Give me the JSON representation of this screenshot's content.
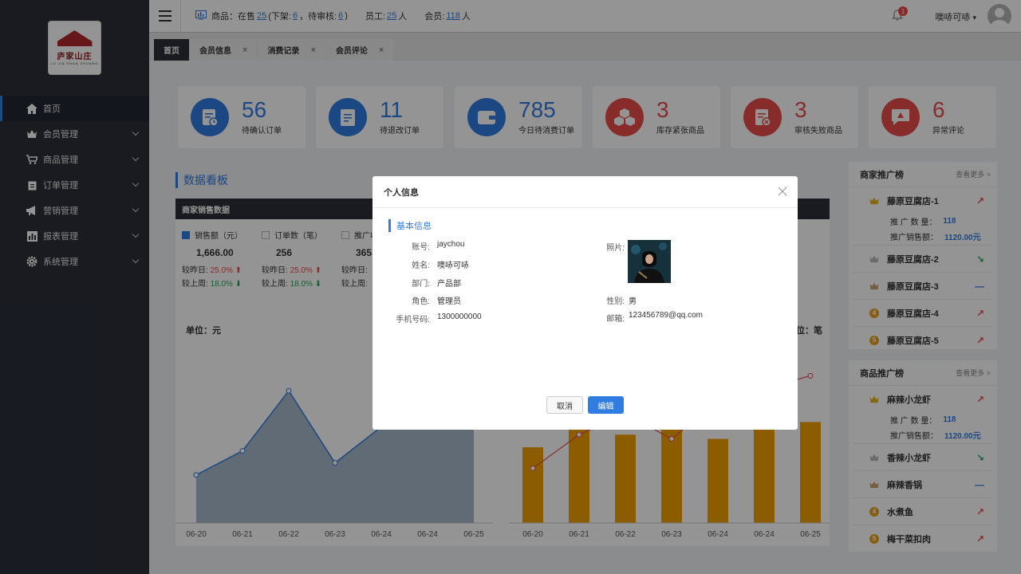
{
  "sidebar": {
    "logo_text": "庐家山庄",
    "logo_sub": "LU JIA SHAN ZHUANG",
    "items": [
      {
        "label": "首页",
        "icon": "home-icon"
      },
      {
        "label": "会员管理",
        "icon": "crown-icon"
      },
      {
        "label": "商品管理",
        "icon": "cart-icon"
      },
      {
        "label": "订单管理",
        "icon": "clipboard-icon"
      },
      {
        "label": "营销管理",
        "icon": "megaphone-icon"
      },
      {
        "label": "报表管理",
        "icon": "bar-chart-icon"
      },
      {
        "label": "系统管理",
        "icon": "gear-icon"
      }
    ]
  },
  "topbar": {
    "goods_label": "商品：在售",
    "on_sale": "25",
    "off_label": "(下架:",
    "off": "6",
    "pending_label": "，待审核:",
    "pending": "6",
    "pending_close": ")",
    "staff_label": "员工:",
    "staff": "25",
    "staff_unit": "人",
    "member_label": "会员:",
    "members": "118",
    "member_unit": "人",
    "notifications": "1",
    "username": "噢哧可哧"
  },
  "tabs": [
    {
      "label": "首页",
      "closable": false
    },
    {
      "label": "会员信息",
      "closable": true
    },
    {
      "label": "消费记录",
      "closable": true
    },
    {
      "label": "会员评论",
      "closable": true
    }
  ],
  "cards": [
    {
      "value": "56",
      "label": "待确认订单",
      "color": "#2f7de1"
    },
    {
      "value": "11",
      "label": "待退改订单",
      "color": "#2f7de1"
    },
    {
      "value": "785",
      "label": "今日待消费订单",
      "color": "#2f7de1"
    },
    {
      "value": "3",
      "label": "库存紧张商品",
      "color": "#e94b4b"
    },
    {
      "value": "3",
      "label": "审核失败商品",
      "color": "#e94b4b"
    },
    {
      "value": "6",
      "label": "异常评论",
      "color": "#e94b4b"
    }
  ],
  "dashboard": {
    "title": "数据看板",
    "panel_title": "商家销售数据",
    "metrics": [
      {
        "label": "销售额（元）",
        "value": "1,666.00",
        "day_label": "较昨日:",
        "day": "25.0%",
        "week_label": "较上周:",
        "week": "18.0%",
        "checked": true
      },
      {
        "label": "订单数（笔）",
        "value": "256",
        "day_label": "较昨日:",
        "day": "25.0%",
        "week_label": "较上周:",
        "week": "18.0%",
        "checked": false
      },
      {
        "label": "推广收",
        "value": "365",
        "day_label": "较昨日:",
        "day": "",
        "week_label": "较上周:",
        "week": "",
        "checked": false
      }
    ],
    "unit_left": "单位：元",
    "unit_right": "位：笔"
  },
  "chart_data": [
    {
      "type": "area",
      "x": [
        "06-20",
        "06-21",
        "06-22",
        "06-23",
        "06-24",
        "06-24",
        "06-25"
      ],
      "series": [
        {
          "values": [
            400,
            600,
            1100,
            500,
            800,
            900,
            1000
          ]
        }
      ],
      "ylim": [
        0,
        1400
      ],
      "color": "#2f7de1"
    },
    {
      "type": "bar",
      "x": [
        "06-20",
        "06-21",
        "06-22",
        "06-23",
        "06-24",
        "06-24",
        "06-25"
      ],
      "series": [
        {
          "values": [
            180,
            270,
            210,
            230,
            200,
            250,
            240
          ],
          "color": "#f0a000"
        },
        {
          "values": [
            130,
            210,
            260,
            200,
            290,
            320,
            350
          ],
          "color": "#e94b4b"
        }
      ],
      "ylim": [
        0,
        400
      ]
    }
  ],
  "merchant_rank": {
    "title": "商家推广榜",
    "more": "查看更多 >",
    "qty_label": "推 广 数 量：",
    "qty": "118",
    "sales_label": "推广销售额：",
    "sales": "1120.00元",
    "items": [
      {
        "name": "藤原豆腐店-1",
        "rank": "1",
        "trend": "up"
      },
      {
        "name": "藤原豆腐店-2",
        "rank": "2",
        "trend": "down"
      },
      {
        "name": "藤原豆腐店-3",
        "rank": "3",
        "trend": "flat"
      },
      {
        "name": "藤原豆腐店-4",
        "rank": "4",
        "trend": "up"
      },
      {
        "name": "藤原豆腐店-5",
        "rank": "5",
        "trend": "up"
      }
    ]
  },
  "goods_rank": {
    "title": "商品推广榜",
    "more": "查看更多 >",
    "qty_label": "推 广 数 量：",
    "qty": "118",
    "sales_label": "推广销售额：",
    "sales": "1120.00元",
    "items": [
      {
        "name": "麻辣小龙虾",
        "rank": "1",
        "trend": "up"
      },
      {
        "name": "香辣小龙虾",
        "rank": "2",
        "trend": "down"
      },
      {
        "name": "麻辣香锅",
        "rank": "3",
        "trend": "flat"
      },
      {
        "name": "水煮鱼",
        "rank": "4",
        "trend": "up"
      },
      {
        "name": "梅干菜扣肉",
        "rank": "5",
        "trend": "up"
      }
    ]
  },
  "modal": {
    "title": "个人信息",
    "section": "基本信息",
    "fields": [
      {
        "label": "账号:",
        "value": "jaychou"
      },
      {
        "label": "姓名:",
        "value": "噢哧可哧"
      },
      {
        "label": "部门:",
        "value": "产品部"
      },
      {
        "label": "角色:",
        "value": "管理员"
      },
      {
        "label": "手机号码:",
        "value": "1300000000"
      }
    ],
    "photo_label": "照片:",
    "gender_label": "性别:",
    "gender": "男",
    "email_label": "邮箱:",
    "email": "123456789@qq.com",
    "cancel": "取消",
    "edit": "编辑"
  }
}
